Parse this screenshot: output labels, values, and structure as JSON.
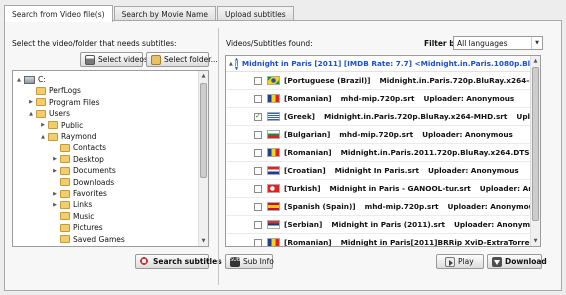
{
  "tabs": [
    {
      "label": "Search from Video file(s)",
      "active": true
    },
    {
      "label": "Search by Movie Name",
      "active": false
    },
    {
      "label": "Upload subtitles",
      "active": false
    }
  ],
  "left": {
    "instruction": "Select the video/folder that needs subtitles:",
    "select_videos_label": "Select videos...",
    "select_folder_label": "Select folder...",
    "search_subtitles_label": "Search subtitles",
    "tree": [
      {
        "label": "C:",
        "type": "drive",
        "arrow": "▲",
        "indent": 0
      },
      {
        "label": "PerfLogs",
        "type": "folder",
        "arrow": "",
        "indent": 1
      },
      {
        "label": "Program Files",
        "type": "folder",
        "arrow": "▶",
        "indent": 1
      },
      {
        "label": "Users",
        "type": "folder",
        "arrow": "▲",
        "indent": 1
      },
      {
        "label": "Public",
        "type": "folder",
        "arrow": "▶",
        "indent": 2
      },
      {
        "label": "Raymond",
        "type": "folder",
        "arrow": "▲",
        "indent": 2
      },
      {
        "label": "Contacts",
        "type": "folder",
        "arrow": "",
        "indent": 3
      },
      {
        "label": "Desktop",
        "type": "folder",
        "arrow": "▶",
        "indent": 3
      },
      {
        "label": "Documents",
        "type": "folder",
        "arrow": "▶",
        "indent": 3
      },
      {
        "label": "Downloads",
        "type": "folder",
        "arrow": "",
        "indent": 3
      },
      {
        "label": "Favorites",
        "type": "folder",
        "arrow": "▶",
        "indent": 3
      },
      {
        "label": "Links",
        "type": "folder",
        "arrow": "▶",
        "indent": 3
      },
      {
        "label": "Music",
        "type": "folder",
        "arrow": "",
        "indent": 3
      },
      {
        "label": "Pictures",
        "type": "folder",
        "arrow": "",
        "indent": 3
      },
      {
        "label": "Saved Games",
        "type": "folder",
        "arrow": "",
        "indent": 3
      }
    ]
  },
  "right": {
    "label": "Videos/Subtitles found:",
    "filter_label": "Filter by:",
    "filter_value": "All languages",
    "movie_header": "Midnight in Paris [2011] [IMDB Rate: 7.7] <Midnight.in.Paris.1080p.BluRay.x264",
    "results": [
      {
        "lang": "[Portuguese (Brazil)]",
        "file": "Midnight.in.Paris.720p.BluRay.x264-MHD.srt",
        "uploader": "Uploader: Anonymous",
        "checked": false,
        "flag": "brazil"
      },
      {
        "lang": "[Romanian]",
        "file": "mhd-mip.720p.srt",
        "uploader": "Uploader: Anonymous",
        "checked": false,
        "flag": "romania"
      },
      {
        "lang": "[Greek]",
        "file": "Midnight.in.Paris.720p.BluRay.x264-MHD.srt",
        "uploader": "Uploader: Anonym",
        "checked": true,
        "flag": "greece"
      },
      {
        "lang": "[Bulgarian]",
        "file": "mhd-mip.720p.srt",
        "uploader": "Uploader: Anonymous",
        "checked": false,
        "flag": "bulgaria"
      },
      {
        "lang": "[Romanian]",
        "file": "Midnight.in.Paris.2011.720p.BluRay.x264.DTS-HDChina.s",
        "uploader": "",
        "checked": false,
        "flag": "romania"
      },
      {
        "lang": "[Croatian]",
        "file": "Midnight In Paris.srt",
        "uploader": "Uploader: Anonymous",
        "checked": false,
        "flag": "croatia"
      },
      {
        "lang": "[Turkish]",
        "file": "Midnight in Paris - GANOOL-tur.srt",
        "uploader": "Uploader: Anonymous",
        "checked": false,
        "flag": "turkey"
      },
      {
        "lang": "[Spanish (Spain)]",
        "file": "mhd-mip.720p.srt",
        "uploader": "Uploader: Anonymous",
        "checked": false,
        "flag": "spain"
      },
      {
        "lang": "[Serbian]",
        "file": "Midnight in Paris (2011).srt",
        "uploader": "Uploader: Anonymous",
        "checked": false,
        "flag": "serbia"
      },
      {
        "lang": "[Romanian]",
        "file": "Midnight in Paris[2011]BRRip XviD-ExtraTorrentRG.srt",
        "uploader": "",
        "checked": false,
        "flag": "romania"
      }
    ],
    "sub_info_label": "Sub Info",
    "play_label": "Play",
    "download_label": "Download"
  },
  "colors": {
    "link_blue": "#1a4fcf",
    "panel_bg": "#f7f7f7"
  }
}
